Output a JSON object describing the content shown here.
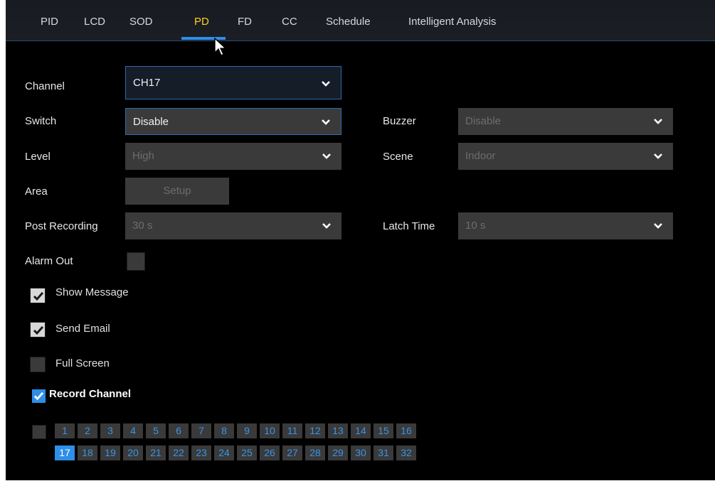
{
  "tabs": [
    "PID",
    "LCD",
    "SOD",
    "PD",
    "FD",
    "CC",
    "Schedule",
    "Intelligent Analysis"
  ],
  "active_tab": "PD",
  "form": {
    "channel": {
      "label": "Channel",
      "value": "CH17"
    },
    "switch": {
      "label": "Switch",
      "value": "Disable"
    },
    "buzzer": {
      "label": "Buzzer",
      "value": "Disable"
    },
    "level": {
      "label": "Level",
      "value": "High"
    },
    "scene": {
      "label": "Scene",
      "value": "Indoor"
    },
    "area": {
      "label": "Area",
      "button": "Setup"
    },
    "post_recording": {
      "label": "Post Recording",
      "value": "30 s"
    },
    "latch_time": {
      "label": "Latch Time",
      "value": "10 s"
    },
    "alarm_out": {
      "label": "Alarm Out",
      "checked": false
    }
  },
  "options": {
    "show_message": {
      "label": "Show Message",
      "checked": true
    },
    "send_email": {
      "label": "Send Email",
      "checked": true
    },
    "full_screen": {
      "label": "Full Screen",
      "checked": false
    },
    "record_channel": {
      "label": "Record Channel",
      "checked": true
    }
  },
  "record_channels": {
    "row1": [
      "1",
      "2",
      "3",
      "4",
      "5",
      "6",
      "7",
      "8",
      "9",
      "10",
      "11",
      "12",
      "13",
      "14",
      "15",
      "16"
    ],
    "row2": [
      "17",
      "18",
      "19",
      "20",
      "21",
      "22",
      "23",
      "24",
      "25",
      "26",
      "27",
      "28",
      "29",
      "30",
      "31",
      "32"
    ],
    "selected": [
      "17"
    ],
    "select_all_checked": false
  },
  "colors": {
    "accent": "#2e8ee8",
    "active_tab": "#ffd21a",
    "field_bg": "#3a3a3a"
  }
}
